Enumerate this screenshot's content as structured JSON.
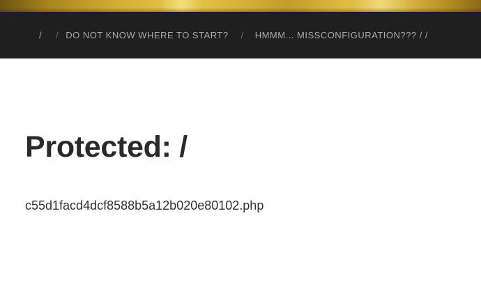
{
  "navigation": {
    "items": [
      {
        "label": "/"
      },
      {
        "label": "/"
      },
      {
        "label": "DO NOT KNOW WHERE TO START?"
      },
      {
        "label": "/"
      },
      {
        "label": "HMMM... MISSCONFIGURATION??? / /"
      }
    ]
  },
  "post": {
    "title": "Protected: /",
    "content": "c55d1facd4dcf8588b5a12b020e80102.php"
  }
}
